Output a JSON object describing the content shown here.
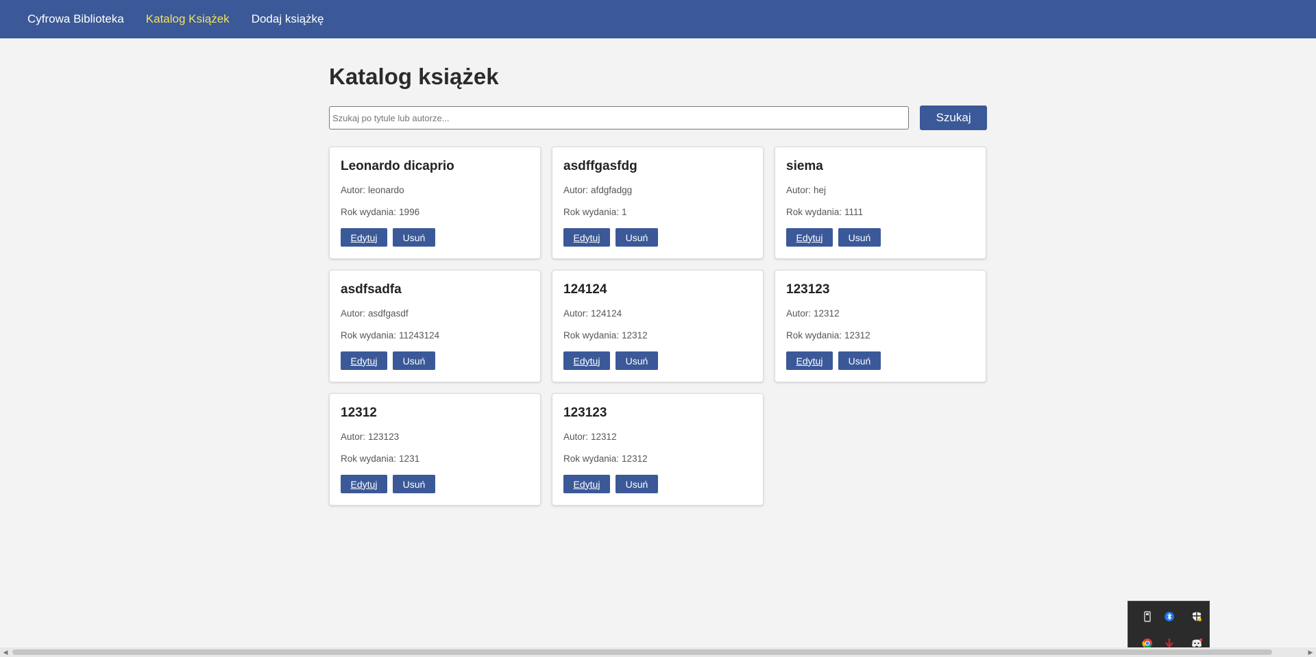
{
  "nav": {
    "brand": "Cyfrowa Biblioteka",
    "catalog": "Katalog Książek",
    "add": "Dodaj książkę"
  },
  "page": {
    "title": "Katalog książek"
  },
  "search": {
    "placeholder": "Szukaj po tytule lub autorze...",
    "button": "Szukaj"
  },
  "labels": {
    "author": "Autor:",
    "year": "Rok wydania:",
    "edit": "Edytuj",
    "delete": "Usuń"
  },
  "books": [
    {
      "title": "Leonardo dicaprio",
      "author": "leonardo",
      "year": "1996"
    },
    {
      "title": "asdffgasfdg",
      "author": "afdgfadgg",
      "year": "1"
    },
    {
      "title": "siema",
      "author": "hej",
      "year": "1111"
    },
    {
      "title": "asdfsadfa",
      "author": "asdfgasdf",
      "year": "11243124"
    },
    {
      "title": "124124",
      "author": "124124",
      "year": "12312"
    },
    {
      "title": "123123",
      "author": "12312",
      "year": "12312"
    },
    {
      "title": "12312",
      "author": "123123",
      "year": "1231"
    },
    {
      "title": "123123",
      "author": "12312",
      "year": "12312"
    }
  ],
  "colors": {
    "nav_bg": "#3b5998",
    "nav_active": "#f5e15a",
    "button_bg": "#3b5998",
    "page_bg": "#f3f3f3"
  },
  "tray_icons": [
    "usb-icon",
    "bluetooth-icon",
    "security-shield-icon",
    "chrome-icon",
    "download-icon",
    "discord-icon"
  ]
}
